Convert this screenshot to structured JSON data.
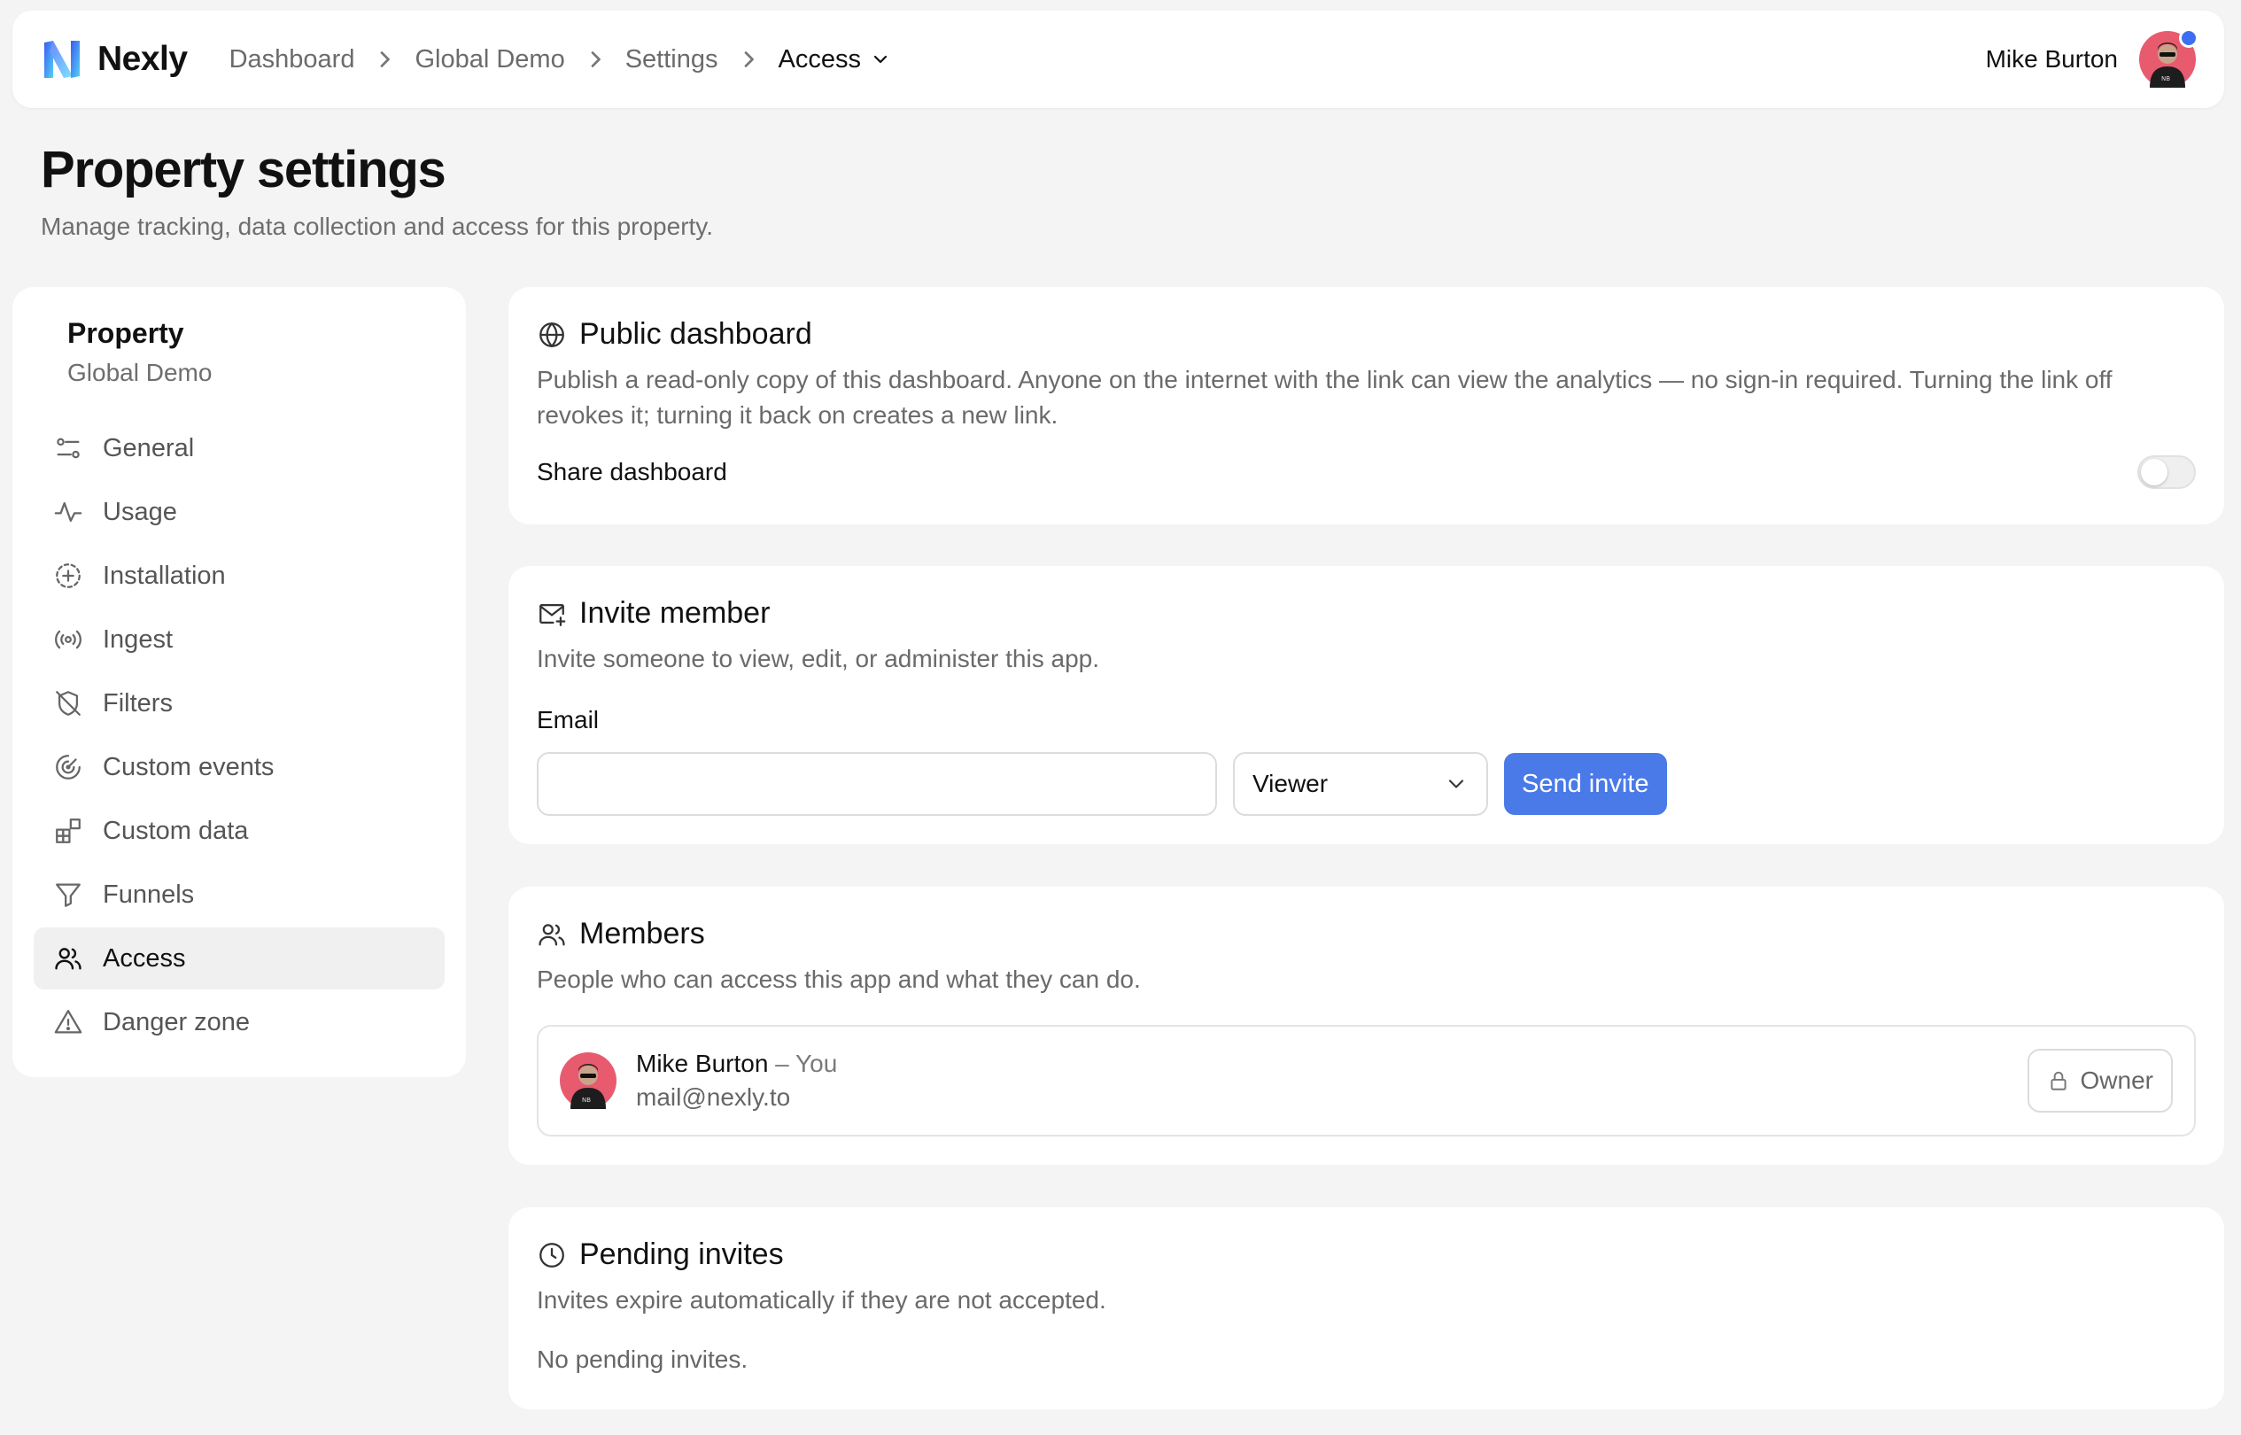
{
  "header": {
    "brand": "Nexly",
    "breadcrumbs": [
      "Dashboard",
      "Global Demo",
      "Settings"
    ],
    "current_crumb": "Access",
    "user_name": "Mike Burton"
  },
  "page": {
    "title": "Property settings",
    "subtitle": "Manage tracking, data collection and access for this property."
  },
  "sidebar": {
    "title": "Property",
    "subtitle": "Global Demo",
    "items": [
      {
        "label": "General",
        "icon": "sliders-icon"
      },
      {
        "label": "Usage",
        "icon": "activity-icon"
      },
      {
        "label": "Installation",
        "icon": "circle-plus-dashed-icon"
      },
      {
        "label": "Ingest",
        "icon": "radio-icon"
      },
      {
        "label": "Filters",
        "icon": "shield-off-icon"
      },
      {
        "label": "Custom events",
        "icon": "target-icon"
      },
      {
        "label": "Custom data",
        "icon": "blocks-icon"
      },
      {
        "label": "Funnels",
        "icon": "funnel-icon"
      },
      {
        "label": "Access",
        "icon": "users-icon",
        "active": true
      },
      {
        "label": "Danger zone",
        "icon": "warning-icon"
      }
    ]
  },
  "public_dashboard": {
    "title": "Public dashboard",
    "description": "Publish a read-only copy of this dashboard. Anyone on the internet with the link can view the analytics — no sign-in required. Turning the link off revokes it; turning it back on creates a new link.",
    "share_label": "Share dashboard",
    "share_enabled": false
  },
  "invite": {
    "title": "Invite member",
    "description": "Invite someone to view, edit, or administer this app.",
    "email_label": "Email",
    "email_value": "",
    "role_selected": "Viewer",
    "send_label": "Send invite"
  },
  "members": {
    "title": "Members",
    "description": "People who can access this app and what they can do.",
    "list": [
      {
        "name": "Mike Burton",
        "you_suffix": " – You",
        "email": "mail@nexly.to",
        "role": "Owner"
      }
    ]
  },
  "pending": {
    "title": "Pending invites",
    "description": "Invites expire automatically if they are not accepted.",
    "empty_text": "No pending invites."
  },
  "colors": {
    "accent": "#4a7ae8",
    "background": "#f4f4f4",
    "avatar_bg": "#e85b6e"
  }
}
